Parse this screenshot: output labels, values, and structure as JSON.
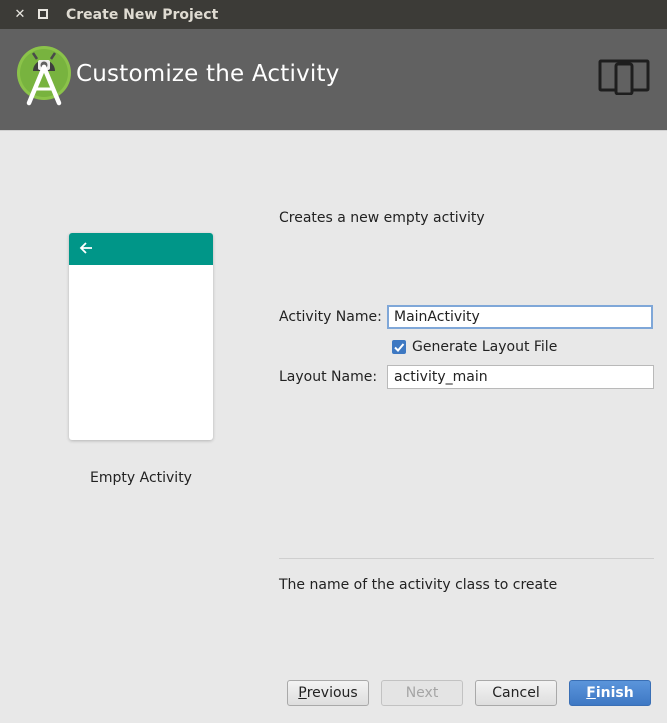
{
  "window": {
    "title": "Create New Project"
  },
  "header": {
    "title": "Customize the Activity"
  },
  "template": {
    "name": "Empty Activity",
    "description": "Creates a new empty activity"
  },
  "form": {
    "activity_name_label": "Activity Name:",
    "activity_name_value": "MainActivity",
    "generate_layout_label": "Generate Layout File",
    "generate_layout_checked": true,
    "layout_name_label": "Layout Name:",
    "layout_name_value": "activity_main"
  },
  "help": {
    "text": "The name of the activity class to create"
  },
  "buttons": {
    "previous_first": "P",
    "previous_rest": "revious",
    "next": "Next",
    "cancel": "Cancel",
    "finish_first": "F",
    "finish_rest": "inish"
  },
  "colors": {
    "header_bg": "#616161",
    "preview_toolbar": "#009688",
    "android_green": "#8bc34a",
    "accent_blue": "#3d78c2"
  },
  "icons": {
    "close": "close-icon",
    "maximize": "maximize-icon",
    "logo": "android-studio-logo",
    "device": "device-form-factor-icon",
    "back_arrow": "back-arrow-icon",
    "checkmark": "checkmark-icon"
  }
}
